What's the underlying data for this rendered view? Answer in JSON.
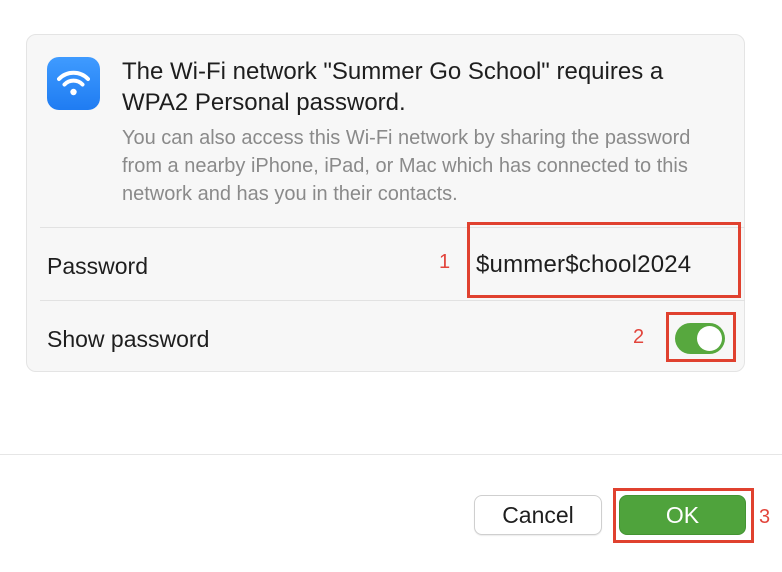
{
  "dialog": {
    "title": "The Wi-Fi network \"Summer Go School\" requires a WPA2 Personal password.",
    "description": "You can also access this Wi-Fi network by sharing the password from a nearby iPhone, iPad, or Mac which has connected to this network and has you in their contacts.",
    "icon": "wifi-icon"
  },
  "password_row": {
    "label": "Password",
    "value": "$ummer$chool2024"
  },
  "show_password_row": {
    "label": "Show password",
    "toggle_on": true
  },
  "buttons": {
    "cancel_label": "Cancel",
    "ok_label": "OK"
  },
  "annotations": {
    "marker_1": "1",
    "marker_2": "2",
    "marker_3": "3",
    "color": "#e0412f"
  },
  "colors": {
    "accent_green": "#4fa33c",
    "icon_blue": "#2b8af7"
  }
}
